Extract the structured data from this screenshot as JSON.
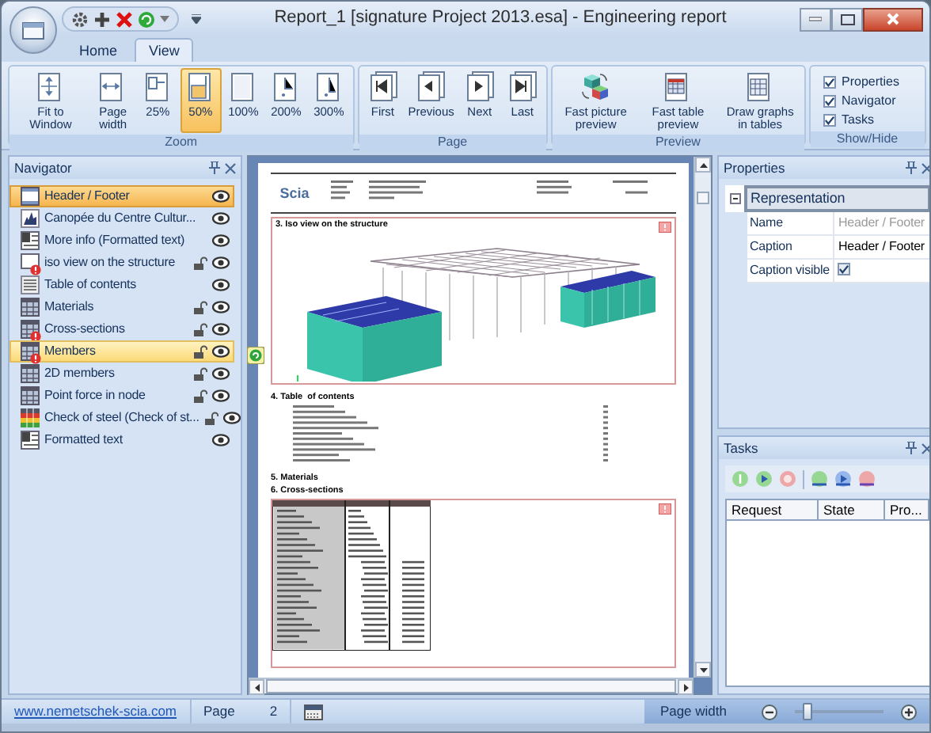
{
  "window": {
    "title": "Report_1 [signature Project 2013.esa] - Engineering report"
  },
  "tabs": [
    {
      "label": "Home",
      "selected": false
    },
    {
      "label": "View",
      "selected": true
    }
  ],
  "ribbon": {
    "groups": [
      {
        "label": "Zoom",
        "kind": "buttons",
        "buttons": [
          {
            "label": "Fit to Window",
            "selected": false
          },
          {
            "label": "Page width",
            "selected": false
          },
          {
            "label": "25%",
            "selected": false
          },
          {
            "label": "50%",
            "selected": true
          },
          {
            "label": "100%",
            "selected": false
          },
          {
            "label": "200%",
            "selected": false
          },
          {
            "label": "300%",
            "selected": false
          }
        ]
      },
      {
        "label": "Page",
        "kind": "buttons",
        "buttons": [
          {
            "label": "First",
            "selected": false
          },
          {
            "label": "Previous",
            "selected": false
          },
          {
            "label": "Next",
            "selected": false
          },
          {
            "label": "Last",
            "selected": false
          }
        ]
      },
      {
        "label": "Preview",
        "kind": "buttons",
        "buttons": [
          {
            "label": "Fast picture preview",
            "selected": false
          },
          {
            "label": "Fast table preview",
            "selected": false
          },
          {
            "label": "Draw graphs in tables",
            "selected": false
          }
        ]
      },
      {
        "label": "Show/Hide",
        "kind": "checks",
        "checks": [
          {
            "label": "Properties",
            "checked": true
          },
          {
            "label": "Navigator",
            "checked": true
          },
          {
            "label": "Tasks",
            "checked": true
          }
        ]
      }
    ]
  },
  "navigator": {
    "title": "Navigator",
    "items": [
      {
        "label": "Header / Footer",
        "kind": "header",
        "selected": true,
        "hovered": false,
        "locked": false,
        "warning": false
      },
      {
        "label": "Canopée du Centre Cultur...",
        "kind": "chart",
        "selected": false,
        "hovered": false,
        "locked": false,
        "warning": false
      },
      {
        "label": "More info (Formatted text)",
        "kind": "text",
        "selected": false,
        "hovered": false,
        "locked": false,
        "warning": false
      },
      {
        "label": "iso view on the structure",
        "kind": "picture",
        "selected": false,
        "hovered": false,
        "locked": true,
        "warning": true
      },
      {
        "label": "Table of contents",
        "kind": "list",
        "selected": false,
        "hovered": false,
        "locked": false,
        "warning": false
      },
      {
        "label": "Materials",
        "kind": "grid",
        "selected": false,
        "hovered": false,
        "locked": true,
        "warning": false
      },
      {
        "label": "Cross-sections",
        "kind": "grid",
        "selected": false,
        "hovered": false,
        "locked": true,
        "warning": true
      },
      {
        "label": "Members",
        "kind": "grid",
        "selected": false,
        "hovered": true,
        "locked": true,
        "warning": true
      },
      {
        "label": "2D members",
        "kind": "grid",
        "selected": false,
        "hovered": false,
        "locked": true,
        "warning": false
      },
      {
        "label": "Point force in node",
        "kind": "grid",
        "selected": false,
        "hovered": false,
        "locked": true,
        "warning": false
      },
      {
        "label": "Check of steel (Check of st...",
        "kind": "colorgrid",
        "selected": false,
        "hovered": false,
        "locked": true,
        "warning": false
      },
      {
        "label": "Formatted text",
        "kind": "text",
        "selected": false,
        "hovered": false,
        "locked": false,
        "warning": false
      }
    ]
  },
  "document": {
    "logo": "Scia",
    "sections": [
      {
        "heading": "3. Iso view on the structure",
        "kind": "model"
      },
      {
        "heading": "4. Table  of contents",
        "kind": "toc"
      },
      {
        "heading": "5. Materials",
        "kind": "none"
      },
      {
        "heading": "6. Cross-sections",
        "kind": "table"
      }
    ]
  },
  "properties": {
    "title": "Properties",
    "group": "Representation",
    "rows": [
      {
        "label": "Name",
        "kind": "text",
        "value": "Header / Footer",
        "readonly": true
      },
      {
        "label": "Caption",
        "kind": "text",
        "value": "Header / Footer",
        "readonly": false
      },
      {
        "label": "Caption visible",
        "kind": "check",
        "checked": true
      }
    ]
  },
  "tasks": {
    "title": "Tasks",
    "columns": [
      "Request",
      "State",
      "Pro..."
    ]
  },
  "status_bar": {
    "link": "www.nemetschek-scia.com",
    "page_label": "Page",
    "page": "2",
    "zoom_mode": "Page width",
    "zoom_slider": {
      "level": 0.15
    }
  }
}
